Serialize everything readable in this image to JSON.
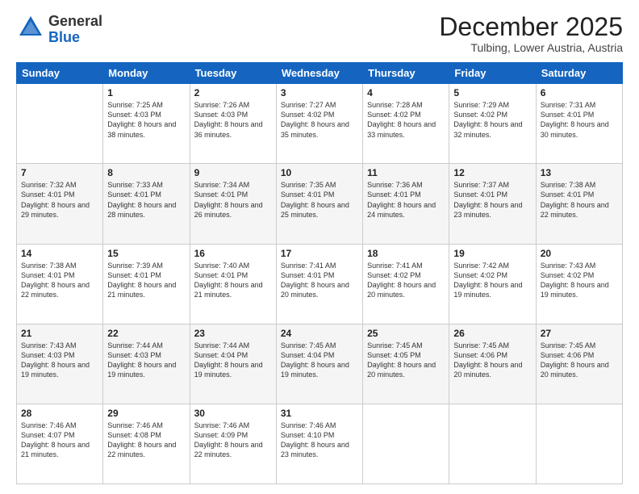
{
  "logo": {
    "general": "General",
    "blue": "Blue"
  },
  "header": {
    "month": "December 2025",
    "location": "Tulbing, Lower Austria, Austria"
  },
  "weekdays": [
    "Sunday",
    "Monday",
    "Tuesday",
    "Wednesday",
    "Thursday",
    "Friday",
    "Saturday"
  ],
  "weeks": [
    [
      {
        "day": "",
        "sunrise": "",
        "sunset": "",
        "daylight": ""
      },
      {
        "day": "1",
        "sunrise": "Sunrise: 7:25 AM",
        "sunset": "Sunset: 4:03 PM",
        "daylight": "Daylight: 8 hours and 38 minutes."
      },
      {
        "day": "2",
        "sunrise": "Sunrise: 7:26 AM",
        "sunset": "Sunset: 4:03 PM",
        "daylight": "Daylight: 8 hours and 36 minutes."
      },
      {
        "day": "3",
        "sunrise": "Sunrise: 7:27 AM",
        "sunset": "Sunset: 4:02 PM",
        "daylight": "Daylight: 8 hours and 35 minutes."
      },
      {
        "day": "4",
        "sunrise": "Sunrise: 7:28 AM",
        "sunset": "Sunset: 4:02 PM",
        "daylight": "Daylight: 8 hours and 33 minutes."
      },
      {
        "day": "5",
        "sunrise": "Sunrise: 7:29 AM",
        "sunset": "Sunset: 4:02 PM",
        "daylight": "Daylight: 8 hours and 32 minutes."
      },
      {
        "day": "6",
        "sunrise": "Sunrise: 7:31 AM",
        "sunset": "Sunset: 4:01 PM",
        "daylight": "Daylight: 8 hours and 30 minutes."
      }
    ],
    [
      {
        "day": "7",
        "sunrise": "Sunrise: 7:32 AM",
        "sunset": "Sunset: 4:01 PM",
        "daylight": "Daylight: 8 hours and 29 minutes."
      },
      {
        "day": "8",
        "sunrise": "Sunrise: 7:33 AM",
        "sunset": "Sunset: 4:01 PM",
        "daylight": "Daylight: 8 hours and 28 minutes."
      },
      {
        "day": "9",
        "sunrise": "Sunrise: 7:34 AM",
        "sunset": "Sunset: 4:01 PM",
        "daylight": "Daylight: 8 hours and 26 minutes."
      },
      {
        "day": "10",
        "sunrise": "Sunrise: 7:35 AM",
        "sunset": "Sunset: 4:01 PM",
        "daylight": "Daylight: 8 hours and 25 minutes."
      },
      {
        "day": "11",
        "sunrise": "Sunrise: 7:36 AM",
        "sunset": "Sunset: 4:01 PM",
        "daylight": "Daylight: 8 hours and 24 minutes."
      },
      {
        "day": "12",
        "sunrise": "Sunrise: 7:37 AM",
        "sunset": "Sunset: 4:01 PM",
        "daylight": "Daylight: 8 hours and 23 minutes."
      },
      {
        "day": "13",
        "sunrise": "Sunrise: 7:38 AM",
        "sunset": "Sunset: 4:01 PM",
        "daylight": "Daylight: 8 hours and 22 minutes."
      }
    ],
    [
      {
        "day": "14",
        "sunrise": "Sunrise: 7:38 AM",
        "sunset": "Sunset: 4:01 PM",
        "daylight": "Daylight: 8 hours and 22 minutes."
      },
      {
        "day": "15",
        "sunrise": "Sunrise: 7:39 AM",
        "sunset": "Sunset: 4:01 PM",
        "daylight": "Daylight: 8 hours and 21 minutes."
      },
      {
        "day": "16",
        "sunrise": "Sunrise: 7:40 AM",
        "sunset": "Sunset: 4:01 PM",
        "daylight": "Daylight: 8 hours and 21 minutes."
      },
      {
        "day": "17",
        "sunrise": "Sunrise: 7:41 AM",
        "sunset": "Sunset: 4:01 PM",
        "daylight": "Daylight: 8 hours and 20 minutes."
      },
      {
        "day": "18",
        "sunrise": "Sunrise: 7:41 AM",
        "sunset": "Sunset: 4:02 PM",
        "daylight": "Daylight: 8 hours and 20 minutes."
      },
      {
        "day": "19",
        "sunrise": "Sunrise: 7:42 AM",
        "sunset": "Sunset: 4:02 PM",
        "daylight": "Daylight: 8 hours and 19 minutes."
      },
      {
        "day": "20",
        "sunrise": "Sunrise: 7:43 AM",
        "sunset": "Sunset: 4:02 PM",
        "daylight": "Daylight: 8 hours and 19 minutes."
      }
    ],
    [
      {
        "day": "21",
        "sunrise": "Sunrise: 7:43 AM",
        "sunset": "Sunset: 4:03 PM",
        "daylight": "Daylight: 8 hours and 19 minutes."
      },
      {
        "day": "22",
        "sunrise": "Sunrise: 7:44 AM",
        "sunset": "Sunset: 4:03 PM",
        "daylight": "Daylight: 8 hours and 19 minutes."
      },
      {
        "day": "23",
        "sunrise": "Sunrise: 7:44 AM",
        "sunset": "Sunset: 4:04 PM",
        "daylight": "Daylight: 8 hours and 19 minutes."
      },
      {
        "day": "24",
        "sunrise": "Sunrise: 7:45 AM",
        "sunset": "Sunset: 4:04 PM",
        "daylight": "Daylight: 8 hours and 19 minutes."
      },
      {
        "day": "25",
        "sunrise": "Sunrise: 7:45 AM",
        "sunset": "Sunset: 4:05 PM",
        "daylight": "Daylight: 8 hours and 20 minutes."
      },
      {
        "day": "26",
        "sunrise": "Sunrise: 7:45 AM",
        "sunset": "Sunset: 4:06 PM",
        "daylight": "Daylight: 8 hours and 20 minutes."
      },
      {
        "day": "27",
        "sunrise": "Sunrise: 7:45 AM",
        "sunset": "Sunset: 4:06 PM",
        "daylight": "Daylight: 8 hours and 20 minutes."
      }
    ],
    [
      {
        "day": "28",
        "sunrise": "Sunrise: 7:46 AM",
        "sunset": "Sunset: 4:07 PM",
        "daylight": "Daylight: 8 hours and 21 minutes."
      },
      {
        "day": "29",
        "sunrise": "Sunrise: 7:46 AM",
        "sunset": "Sunset: 4:08 PM",
        "daylight": "Daylight: 8 hours and 22 minutes."
      },
      {
        "day": "30",
        "sunrise": "Sunrise: 7:46 AM",
        "sunset": "Sunset: 4:09 PM",
        "daylight": "Daylight: 8 hours and 22 minutes."
      },
      {
        "day": "31",
        "sunrise": "Sunrise: 7:46 AM",
        "sunset": "Sunset: 4:10 PM",
        "daylight": "Daylight: 8 hours and 23 minutes."
      },
      {
        "day": "",
        "sunrise": "",
        "sunset": "",
        "daylight": ""
      },
      {
        "day": "",
        "sunrise": "",
        "sunset": "",
        "daylight": ""
      },
      {
        "day": "",
        "sunrise": "",
        "sunset": "",
        "daylight": ""
      }
    ]
  ]
}
